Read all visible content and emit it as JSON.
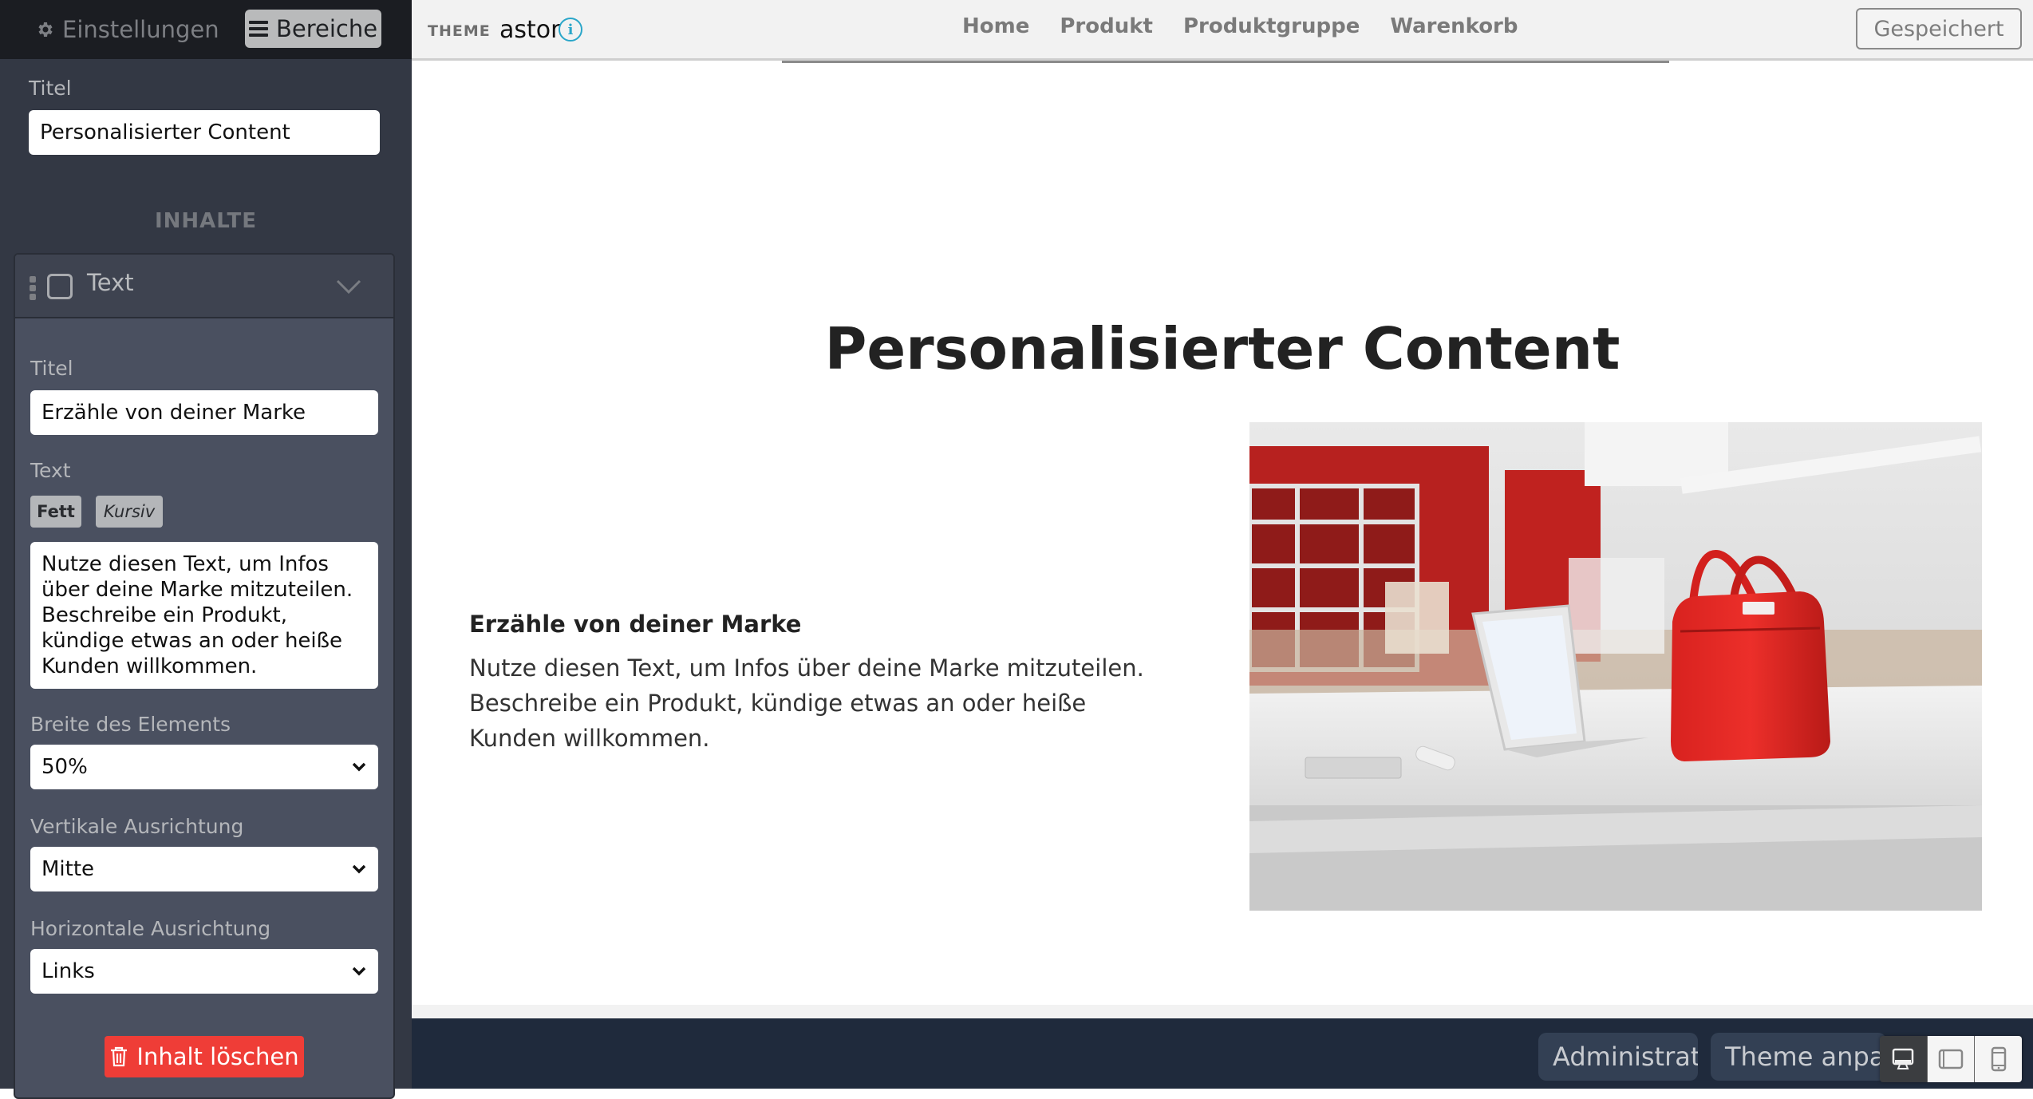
{
  "sidebar": {
    "tabs": {
      "settings_label": "Einstellungen",
      "areas_label": "Bereiche",
      "active": "Bereiche"
    },
    "section": {
      "title_label": "Titel",
      "title_value": "Personalisierter Content"
    },
    "contents_heading": "INHALTE",
    "content_block": {
      "type_label": "Text",
      "title_label": "Titel",
      "title_value": "Erzähle von deiner Marke",
      "text_label": "Text",
      "bold_label": "Fett",
      "italic_label": "Kursiv",
      "text_value": "Nutze diesen Text, um Infos über deine Marke mitzuteilen. Beschreibe ein Produkt, kündige etwas an oder heiße Kunden willkommen.",
      "width_label": "Breite des Elements",
      "width_value": "50%",
      "valign_label": "Vertikale Ausrichtung",
      "valign_value": "Mitte",
      "halign_label": "Horizontale Ausrichtung",
      "halign_value": "Links",
      "delete_label": "Inhalt löschen"
    }
  },
  "topbar": {
    "theme_label": "THEME",
    "theme_name": "astor",
    "nav": [
      "Home",
      "Produkt",
      "Produktgruppe",
      "Warenkorb"
    ],
    "save_status": "Gespeichert"
  },
  "preview": {
    "section_title": "Personalisierter Content",
    "text_heading": "Erzähle von deiner Marke",
    "text_body": "Nutze diesen Text, um Infos über deine Marke mitzuteilen. Beschreibe ein Produkt, kündige etwas an oder heiße Kunden willkommen.",
    "image_description": "Red handbag next to a laptop on a white table in a store"
  },
  "bottombar": {
    "admin_label": "Administration",
    "theme_label": "Theme anpassen",
    "devices": [
      "desktop",
      "tablet",
      "mobile"
    ],
    "active_device": "desktop"
  },
  "colors": {
    "sidebar_bg": "#333844",
    "delete_red": "#ef3d37",
    "info_blue": "#2aa6c9",
    "bottombar_bg": "#1f2a3c"
  }
}
